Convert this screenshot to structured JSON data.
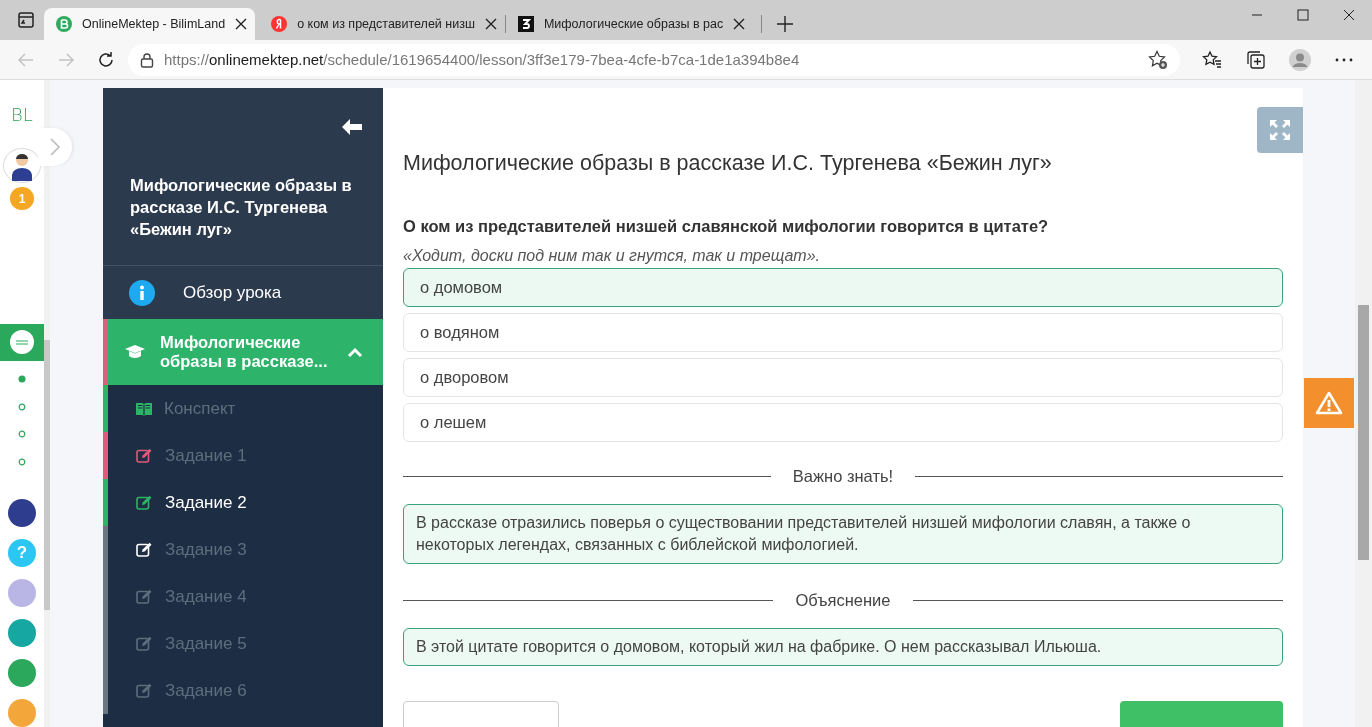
{
  "browser": {
    "tabs": [
      {
        "title": "OnlineMektep - BilimLand",
        "selected": true
      },
      {
        "title": "о ком из представителей низш",
        "selected": false
      },
      {
        "title": "Мифологические образы в рас",
        "selected": false
      }
    ],
    "address": {
      "scheme": "https://",
      "host": "onlinemektep.net",
      "path": "/schedule/1619654400/lesson/3ff3e179-7bea-4cfe-b7ca-1de1a394b8e4"
    }
  },
  "rail": {
    "logo": "BL",
    "badge": "1",
    "steps": [
      {
        "selected": true
      },
      {
        "selected": false
      },
      {
        "selected": false
      },
      {
        "selected": false
      }
    ],
    "apps": [
      {
        "color": "#2f3d8f"
      },
      {
        "color": "#2cc6f2",
        "glyph": "?"
      },
      {
        "color": "#b9b6e6"
      },
      {
        "color": "#17a7a2"
      },
      {
        "color": "#2ba85b"
      },
      {
        "color": "#f3a73a"
      }
    ]
  },
  "sidebar": {
    "title": "Мифологические образы в рассказе И.С. Тургенева «Бежин луг»",
    "overview": "Обзор урока",
    "section": {
      "title": "Мифологические образы в рассказе...",
      "expanded": true,
      "items": [
        {
          "label": "Конспект",
          "kind": "notes",
          "color": "#2eb466",
          "selected": false
        },
        {
          "label": "Задание 1",
          "kind": "task",
          "color": "#e05a7c",
          "selected": false
        },
        {
          "label": "Задание 2",
          "kind": "task",
          "color": "#2eb466",
          "selected": true
        },
        {
          "label": "Задание 3",
          "kind": "task",
          "color": "#ffffff",
          "selected": false
        },
        {
          "label": "Задание 4",
          "kind": "task",
          "color": "#5e6d7e",
          "selected": false
        },
        {
          "label": "Задание 5",
          "kind": "task",
          "color": "#5e6d7e",
          "selected": false
        },
        {
          "label": "Задание 6",
          "kind": "task",
          "color": "#5e6d7e",
          "selected": false
        }
      ]
    }
  },
  "lesson": {
    "title": "Мифологические образы в рассказе И.С. Тургенева «Бежин луг»",
    "question": "О ком из представителей низшей славянской мифологии говорится в цитате?",
    "quote": "«Ходит, доски под ним так и гнутся, так и трещат».",
    "options": [
      {
        "text": "о домовом",
        "selected": true
      },
      {
        "text": "о водяном",
        "selected": false
      },
      {
        "text": "о дворовом",
        "selected": false
      },
      {
        "text": "о лешем",
        "selected": false
      }
    ],
    "notes": [
      {
        "heading": "Важно знать!",
        "text": "В рассказе отразились поверья о существовании представителей низшей мифологии славян, а также о некоторых легендах, связанных с библейской мифологией."
      },
      {
        "heading": "Объяснение",
        "text": "В этой цитате говорится о домовом, который жил на фабрике. О нем рассказывал Ильюша."
      }
    ]
  }
}
